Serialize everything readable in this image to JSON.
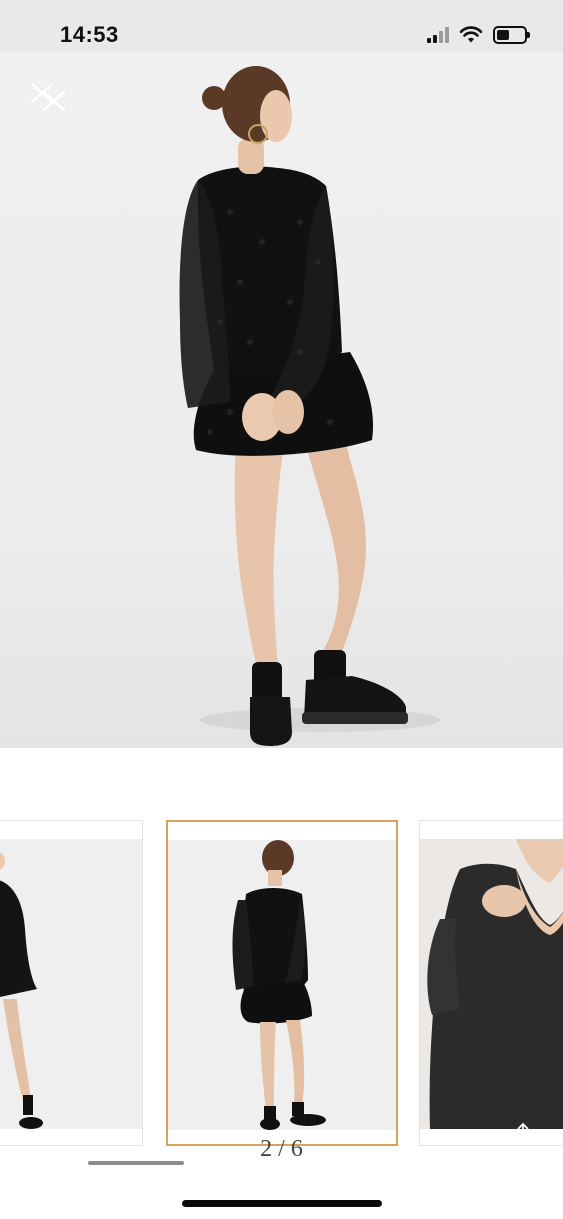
{
  "status_bar": {
    "time": "14:53",
    "battery_level": 0.45,
    "signal_bars_active": 2,
    "signal_bars_total": 4
  },
  "viewer": {
    "close_icon": "close-icon",
    "main_image_description_icon": "product-photo-back-view"
  },
  "gallery": {
    "current_page": 2,
    "total_pages": 6,
    "page_indicator": "2 / 6",
    "selected_border_color": "#d9a25c"
  },
  "colors": {
    "status_bar_bg": "#e9e9e9",
    "photo_bg": "#ececec",
    "dress": "#0f0f0f",
    "skin": "#e9c7ad"
  }
}
